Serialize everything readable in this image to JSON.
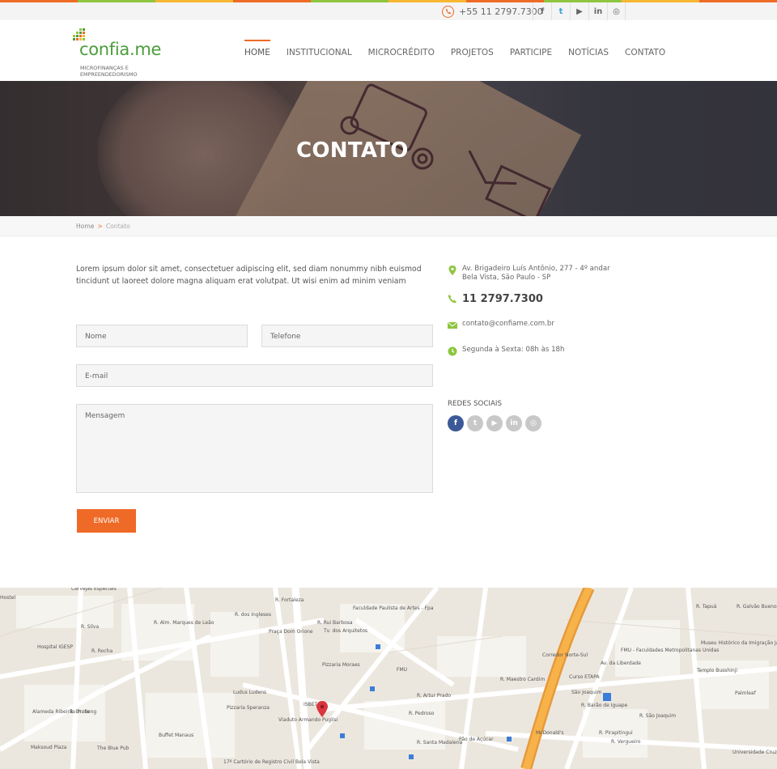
{
  "colors": {
    "accent": "#ef6a26",
    "brand_green": "#4a9d3a",
    "facebook": "#3b5998"
  },
  "stripe_colors": [
    "#ef6a26",
    "#8dc63f",
    "#f7b731",
    "#ef6a26",
    "#8dc63f",
    "#f7b731",
    "#ef6a26",
    "#8dc63f",
    "#f7b731",
    "#ef6a26"
  ],
  "topbar": {
    "phone": "+55 11 2797.7300",
    "social": [
      {
        "name": "facebook",
        "glyph": "f"
      },
      {
        "name": "twitter",
        "glyph": "t"
      },
      {
        "name": "youtube",
        "glyph": "▶"
      },
      {
        "name": "linkedin",
        "glyph": "in"
      },
      {
        "name": "instagram",
        "glyph": "◎"
      }
    ]
  },
  "logo": {
    "brand": "confia.me",
    "tagline_1": "MICROFINANÇAS E",
    "tagline_2": "EMPREENDEDORISMO"
  },
  "nav": {
    "items": [
      "HOME",
      "INSTITUCIONAL",
      "MICROCRÉDITO",
      "PROJETOS",
      "PARTICIPE",
      "NOTÍCIAS",
      "CONTATO"
    ],
    "active": "HOME"
  },
  "hero": {
    "title": "CONTATO"
  },
  "breadcrumb": {
    "home": "Home",
    "sep": ">",
    "current": "Contato"
  },
  "intro": "Lorem ipsum dolor sit amet, consectetuer adipiscing elit, sed diam nonummy nibh euismod tincidunt ut laoreet dolore magna aliquam erat volutpat. Ut wisi enim ad minim veniam",
  "form": {
    "name_placeholder": "Nome",
    "phone_placeholder": "Telefone",
    "email_placeholder": "E-mail",
    "message_placeholder": "Mensagem",
    "submit": "ENVIAR"
  },
  "contact": {
    "address_1": "Av. Brigadeiro Luís Antônio, 277 - 4º andar",
    "address_2": "Bela Vista, São Paulo - SP",
    "phone": "11 2797.7300",
    "email": "contato@confiame.com.br",
    "hours": "Segunda à Sexta: 08h às 18h"
  },
  "social_title": "REDES SOCIAIS",
  "social_circles": [
    {
      "name": "facebook",
      "glyph": "f"
    },
    {
      "name": "twitter",
      "glyph": "t"
    },
    {
      "name": "youtube",
      "glyph": "▶"
    },
    {
      "name": "linkedin",
      "glyph": "in"
    },
    {
      "name": "instagram",
      "glyph": "◎"
    }
  ],
  "map": {
    "labels": [
      "Cervejas Especiais",
      "Hostel",
      "Hospital IGESP",
      "R. Silva",
      "R. Rocha",
      "R. Fortaleza",
      "Praça Dom Orione",
      "Faculdade Paulista de Artes - Fpa",
      "Tv. dos Arquitetos",
      "Pizzaria Moraes",
      "FMU",
      "Ludus Ludens",
      "Pizzaria Speranza",
      "ISBET",
      "Buffet Manaus",
      "The Blue Pub",
      "Maksoud Plaza",
      "R. Pedroso",
      "R. Santa Madalena",
      "McDonald's",
      "Pão de Açúcar",
      "Curso ETAPA",
      "São Joaquim",
      "FMU - Faculdades Metropolitanas Unidas",
      "Museu Histórico da Imigração Japonesa",
      "Templo Busshinji",
      "Palmleaf",
      "17º Cartório de Registro Civil Bela Vista",
      "Viaduto Armando Puglisi",
      "Corredor Norte-Sul",
      "R. Maestro Cardim",
      "R. Barão de Iguape",
      "R. Vergueiro",
      "Av. da Liberdade",
      "R. Pirapitingui",
      "R. São Joaquim",
      "Alameda Ribeirão Preto",
      "R. Dr. Seng",
      "R. Alm. Marques de Leão",
      "R. dos Ingleses",
      "R. Rui Barbosa",
      "R. Artur Prado",
      "R. Galvão Bueno",
      "R. Tapuá",
      "Universidade Cruzeiro do Sul"
    ]
  }
}
